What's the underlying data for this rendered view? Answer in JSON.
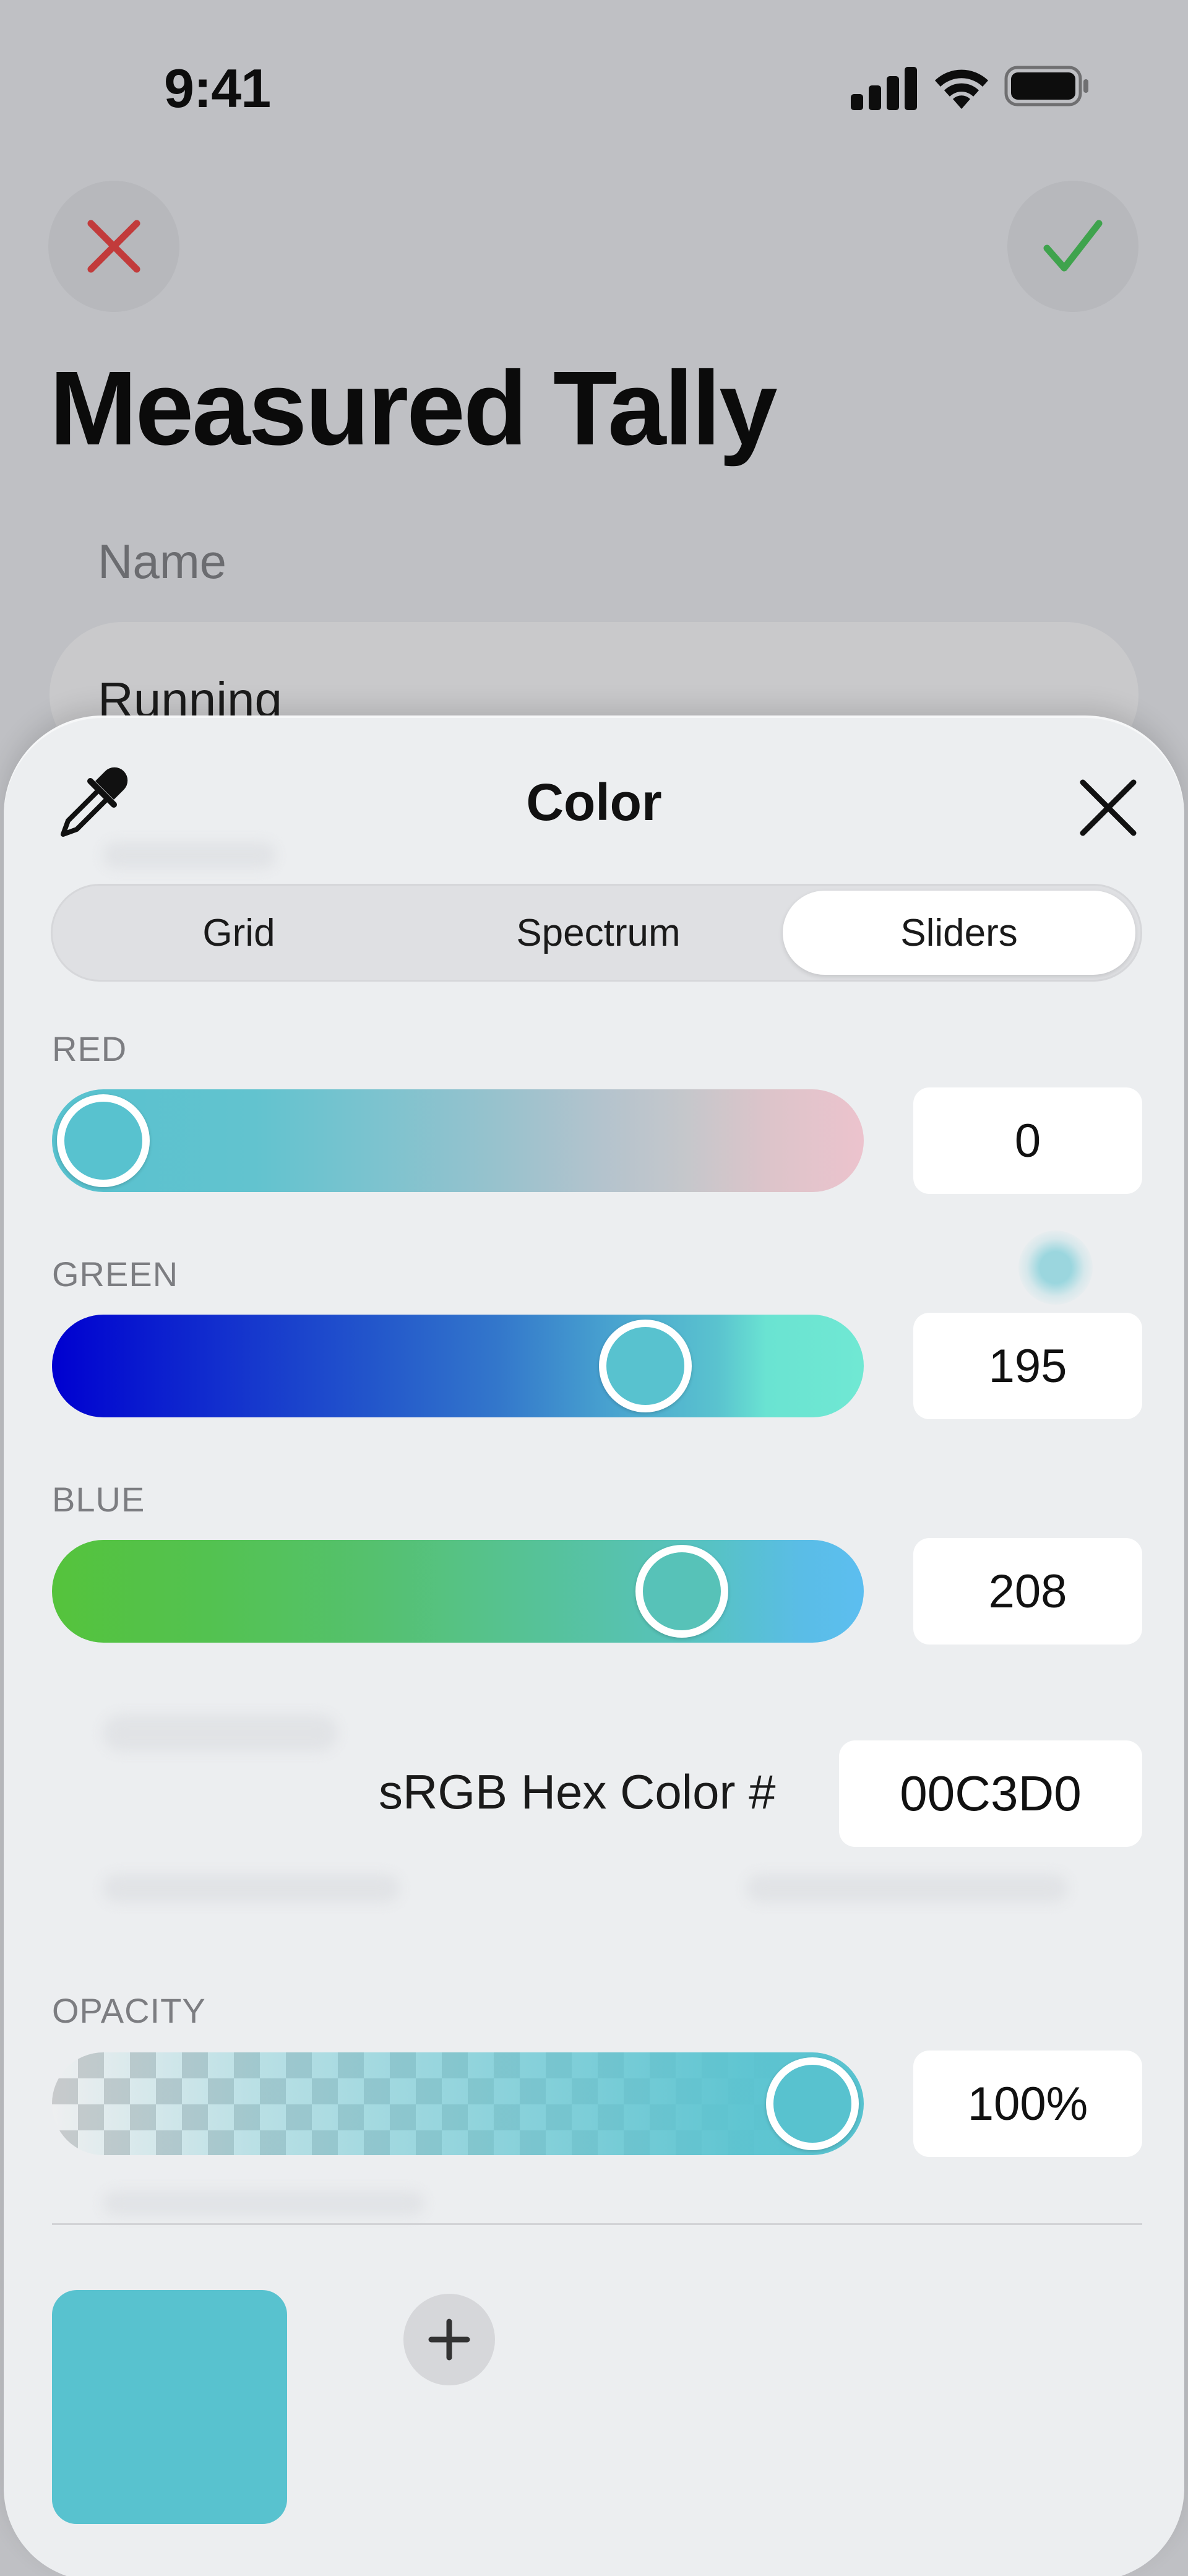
{
  "status_bar": {
    "time": "9:41",
    "signal_icon": "cellular-signal-icon",
    "wifi_icon": "wifi-icon",
    "battery_icon": "battery-icon"
  },
  "header": {
    "cancel_icon": "close-x-icon",
    "confirm_icon": "checkmark-icon",
    "title": "Measured Tally"
  },
  "form": {
    "name_label": "Name",
    "name_value": "Running"
  },
  "color_picker": {
    "title": "Color",
    "eyedropper_icon": "eyedropper-icon",
    "close_icon": "close-x-icon",
    "tabs": [
      {
        "label": "Grid",
        "selected": false
      },
      {
        "label": "Spectrum",
        "selected": false
      },
      {
        "label": "Sliders",
        "selected": true
      }
    ],
    "channels": {
      "red": {
        "label": "RED",
        "value": "0",
        "level": 0
      },
      "green": {
        "label": "GREEN",
        "value": "195",
        "level": 195
      },
      "blue": {
        "label": "BLUE",
        "value": "208",
        "level": 208
      }
    },
    "hex": {
      "label": "sRGB Hex Color #",
      "value": "00C3D0"
    },
    "opacity": {
      "label": "OPACITY",
      "value": "100%",
      "level": 100
    },
    "current_color": "#58C2CF",
    "add_swatch_icon": "plus-icon"
  },
  "colors": {
    "cancel_red": "#C23B3B",
    "confirm_green": "#3FA34D",
    "selected_color": "#00C3D0"
  }
}
